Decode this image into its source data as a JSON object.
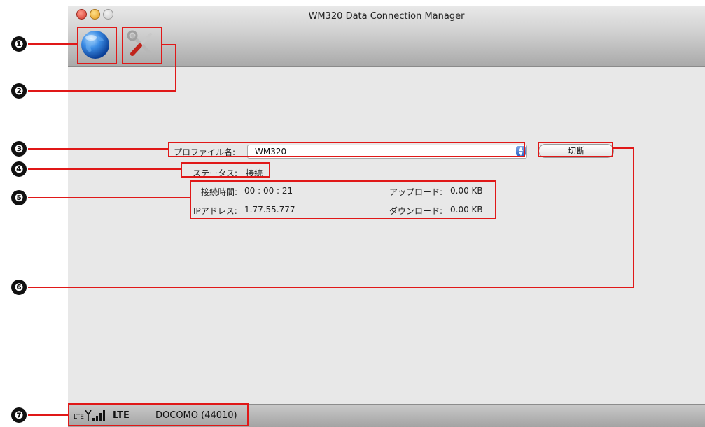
{
  "window": {
    "title": "WM320 Data Connection Manager"
  },
  "toolbar": {
    "items": [
      {
        "icon": "globe-icon"
      },
      {
        "icon": "tools-icon"
      }
    ]
  },
  "callouts": [
    "❶",
    "❷",
    "❸",
    "❹",
    "❺",
    "❻",
    "❼"
  ],
  "connection": {
    "profile_label": "プロファイル名:",
    "profile_value": "WM320",
    "disconnect_label": "切断",
    "status_label": "ステータス:",
    "status_value": "接続",
    "time_label": "接続時間:",
    "time_value": "00 : 00 : 21",
    "ip_label": "IPアドレス:",
    "ip_value": "1.77.55.777",
    "upload_label": "アップロード:",
    "upload_value": "0.00 KB",
    "download_label": "ダウンロード:",
    "download_value": "0.00 KB"
  },
  "statusbar": {
    "signal_prefix": "LTE",
    "network_type": "LTE",
    "carrier": "DOCOMO (44010)"
  },
  "colors": {
    "highlight": "#e01818",
    "window_bg": "#e8e8e8"
  }
}
